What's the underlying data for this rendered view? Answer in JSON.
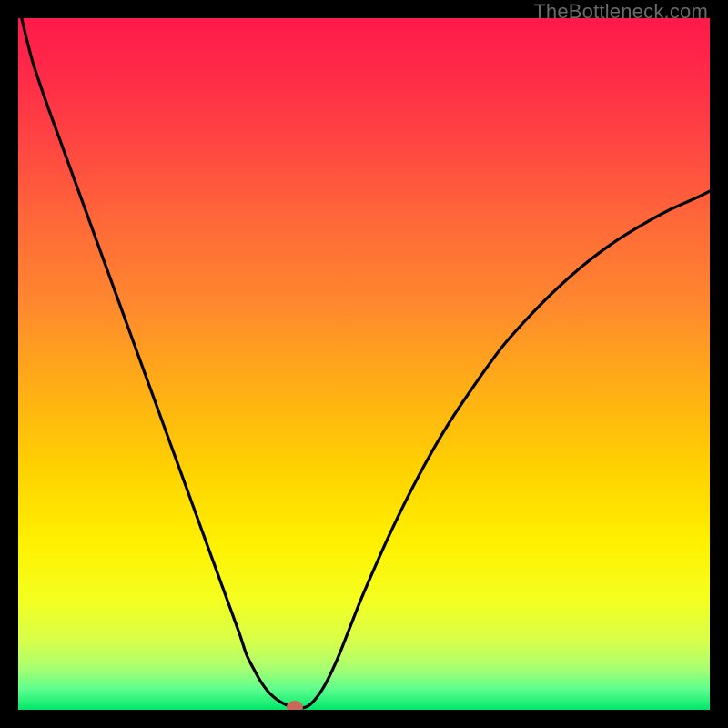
{
  "attribution": "TheBottleneck.com",
  "chart_data": {
    "type": "line",
    "title": "",
    "xlabel": "",
    "ylabel": "",
    "xlim": [
      0,
      100
    ],
    "ylim": [
      0,
      100
    ],
    "series": [
      {
        "name": "bottleneck-curve",
        "x": [
          0.5,
          2,
          4,
          6,
          8,
          10,
          12,
          14,
          16,
          18,
          20,
          22,
          24,
          26,
          28,
          30,
          32,
          33,
          34,
          35,
          36,
          37,
          38,
          39,
          40,
          42,
          44,
          46,
          48,
          50,
          54,
          58,
          62,
          66,
          70,
          74,
          78,
          82,
          86,
          90,
          94,
          98,
          100
        ],
        "y": [
          100,
          94,
          88,
          82.5,
          77,
          71.5,
          66,
          60.5,
          55,
          49.5,
          44,
          38.5,
          33,
          27.5,
          22,
          16.5,
          11,
          8,
          6,
          4.2,
          2.8,
          1.8,
          1.1,
          0.6,
          0.2,
          0.6,
          3,
          7,
          12,
          17,
          26,
          34,
          41,
          47,
          52.5,
          57,
          61,
          64.5,
          67.5,
          70,
          72.2,
          74,
          75
        ]
      }
    ],
    "marker": {
      "name": "optimal-point",
      "x": 40,
      "y": 0,
      "color": "#c76a55"
    },
    "gradient_stops": [
      {
        "offset": 0.0,
        "color": "#ff1a4b"
      },
      {
        "offset": 0.08,
        "color": "#ff2a48"
      },
      {
        "offset": 0.18,
        "color": "#ff4542"
      },
      {
        "offset": 0.3,
        "color": "#ff6a38"
      },
      {
        "offset": 0.42,
        "color": "#ff8a2e"
      },
      {
        "offset": 0.54,
        "color": "#ffb014"
      },
      {
        "offset": 0.66,
        "color": "#ffd400"
      },
      {
        "offset": 0.76,
        "color": "#fff100"
      },
      {
        "offset": 0.84,
        "color": "#f4ff20"
      },
      {
        "offset": 0.9,
        "color": "#d8ff4a"
      },
      {
        "offset": 0.94,
        "color": "#a8ff70"
      },
      {
        "offset": 0.97,
        "color": "#5fff8e"
      },
      {
        "offset": 1.0,
        "color": "#00e56a"
      }
    ]
  }
}
